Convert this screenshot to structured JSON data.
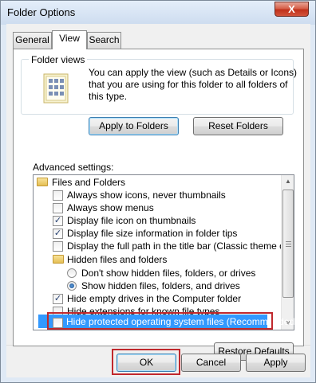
{
  "window": {
    "title": "Folder Options",
    "close_label": "X"
  },
  "tabs": [
    {
      "label": "General"
    },
    {
      "label": "View"
    },
    {
      "label": "Search"
    }
  ],
  "folder_views": {
    "label": "Folder views",
    "description": "You can apply the view (such as Details or Icons) that you are using for this folder to all folders of this type.",
    "apply_button": "Apply to Folders",
    "reset_button": "Reset Folders"
  },
  "advanced": {
    "label": "Advanced settings:",
    "items": [
      {
        "type": "folder",
        "label": "Files and Folders"
      },
      {
        "type": "checkbox",
        "label": "Always show icons, never thumbnails",
        "checked": false
      },
      {
        "type": "checkbox",
        "label": "Always show menus",
        "checked": false
      },
      {
        "type": "checkbox",
        "label": "Display file icon on thumbnails",
        "checked": true
      },
      {
        "type": "checkbox",
        "label": "Display file size information in folder tips",
        "checked": true
      },
      {
        "type": "checkbox",
        "label": "Display the full path in the title bar (Classic theme only)",
        "checked": false
      },
      {
        "type": "folder",
        "label": "Hidden files and folders"
      },
      {
        "type": "radio",
        "label": "Don't show hidden files, folders, or drives",
        "selected": false
      },
      {
        "type": "radio",
        "label": "Show hidden files, folders, and drives",
        "selected": true
      },
      {
        "type": "checkbox",
        "label": "Hide empty drives in the Computer folder",
        "checked": true
      },
      {
        "type": "checkbox",
        "label": "Hide extensions for known file types",
        "checked": false
      },
      {
        "type": "checkbox",
        "label": "Hide protected operating system files (Recommended)",
        "checked": false,
        "selected_row": true
      }
    ],
    "restore_button": "Restore Defaults"
  },
  "footer": {
    "ok": "OK",
    "cancel": "Cancel",
    "apply": "Apply"
  },
  "colors": {
    "selection": "#3399ff",
    "highlight_box": "#c0282d"
  }
}
